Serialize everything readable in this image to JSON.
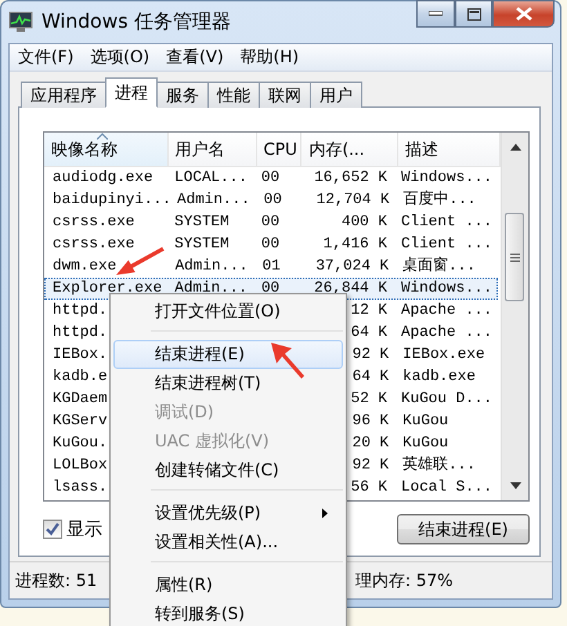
{
  "window": {
    "title": "Windows 任务管理器"
  },
  "menu": [
    "文件(F)",
    "选项(O)",
    "查看(V)",
    "帮助(H)"
  ],
  "tabs": [
    {
      "label": "应用程序",
      "selected": false
    },
    {
      "label": "进程",
      "selected": true
    },
    {
      "label": "服务",
      "selected": false
    },
    {
      "label": "性能",
      "selected": false
    },
    {
      "label": "联网",
      "selected": false
    },
    {
      "label": "用户",
      "selected": false
    }
  ],
  "table": {
    "columns": [
      "映像名称",
      "用户名",
      "CPU",
      "内存(...",
      "描述"
    ],
    "rows": [
      {
        "name": "audiodg.exe",
        "user": "LOCAL...",
        "cpu": "00",
        "memory": "16,652 K",
        "description": "Windows...",
        "selected": false
      },
      {
        "name": "baidupinyi...",
        "user": "Admin...",
        "cpu": "00",
        "memory": "12,704 K",
        "description": "百度中...",
        "selected": false
      },
      {
        "name": "csrss.exe",
        "user": "SYSTEM",
        "cpu": "00",
        "memory": "400 K",
        "description": "Client ...",
        "selected": false
      },
      {
        "name": "csrss.exe",
        "user": "SYSTEM",
        "cpu": "00",
        "memory": "1,416 K",
        "description": "Client ...",
        "selected": false
      },
      {
        "name": "dwm.exe",
        "user": "Admin...",
        "cpu": "01",
        "memory": "37,024 K",
        "description": "桌面窗...",
        "selected": false
      },
      {
        "name": "Explorer.exe",
        "user": "Admin...",
        "cpu": "00",
        "memory": "26,844 K",
        "description": "Windows...",
        "selected": true
      },
      {
        "name": "httpd.",
        "memory": "12 K",
        "description": "Apache ...",
        "selected": false
      },
      {
        "name": "httpd.",
        "memory": "64 K",
        "description": "Apache ...",
        "selected": false
      },
      {
        "name": "IEBox.",
        "memory": "92 K",
        "description": "IEBox.exe",
        "selected": false
      },
      {
        "name": "kadb.e",
        "memory": "64 K",
        "description": "kadb.exe",
        "selected": false
      },
      {
        "name": "KGDaem",
        "memory": "52 K",
        "description": "KuGou D...",
        "selected": false
      },
      {
        "name": "KGServ",
        "memory": "96 K",
        "description": "KuGou",
        "selected": false
      },
      {
        "name": "KuGou.",
        "memory": "20 K",
        "description": "KuGou",
        "selected": false
      },
      {
        "name": "LOLBox",
        "memory": "92 K",
        "description": "英雄联...",
        "selected": false
      },
      {
        "name": "lsass.",
        "memory": "56 K",
        "description": "Local S...",
        "selected": false
      }
    ]
  },
  "show_all_checkbox": {
    "label": "显示",
    "checked": true
  },
  "end_process_button": "结束进程(E)",
  "status_bar": [
    "进程数: 51",
    "理内存: 57%"
  ],
  "context_menu": [
    {
      "kind": "item",
      "label": "打开文件位置(O)",
      "disabled": false,
      "selected": false,
      "submenu": false
    },
    {
      "kind": "separator"
    },
    {
      "kind": "item",
      "label": "结束进程(E)",
      "disabled": false,
      "selected": true,
      "submenu": false
    },
    {
      "kind": "item",
      "label": "结束进程树(T)",
      "disabled": false,
      "selected": false,
      "submenu": false
    },
    {
      "kind": "item",
      "label": "调试(D)",
      "disabled": true,
      "selected": false,
      "submenu": false
    },
    {
      "kind": "item",
      "label": "UAC 虚拟化(V)",
      "disabled": true,
      "selected": false,
      "submenu": false
    },
    {
      "kind": "item",
      "label": "创建转储文件(C)",
      "disabled": false,
      "selected": false,
      "submenu": false
    },
    {
      "kind": "separator"
    },
    {
      "kind": "item",
      "label": "设置优先级(P)",
      "disabled": false,
      "selected": false,
      "submenu": true
    },
    {
      "kind": "item",
      "label": "设置相关性(A)...",
      "disabled": false,
      "selected": false,
      "submenu": false
    },
    {
      "kind": "separator"
    },
    {
      "kind": "item",
      "label": "属性(R)",
      "disabled": false,
      "selected": false,
      "submenu": false
    },
    {
      "kind": "item",
      "label": "转到服务(S)",
      "disabled": false,
      "selected": false,
      "submenu": false
    }
  ]
}
